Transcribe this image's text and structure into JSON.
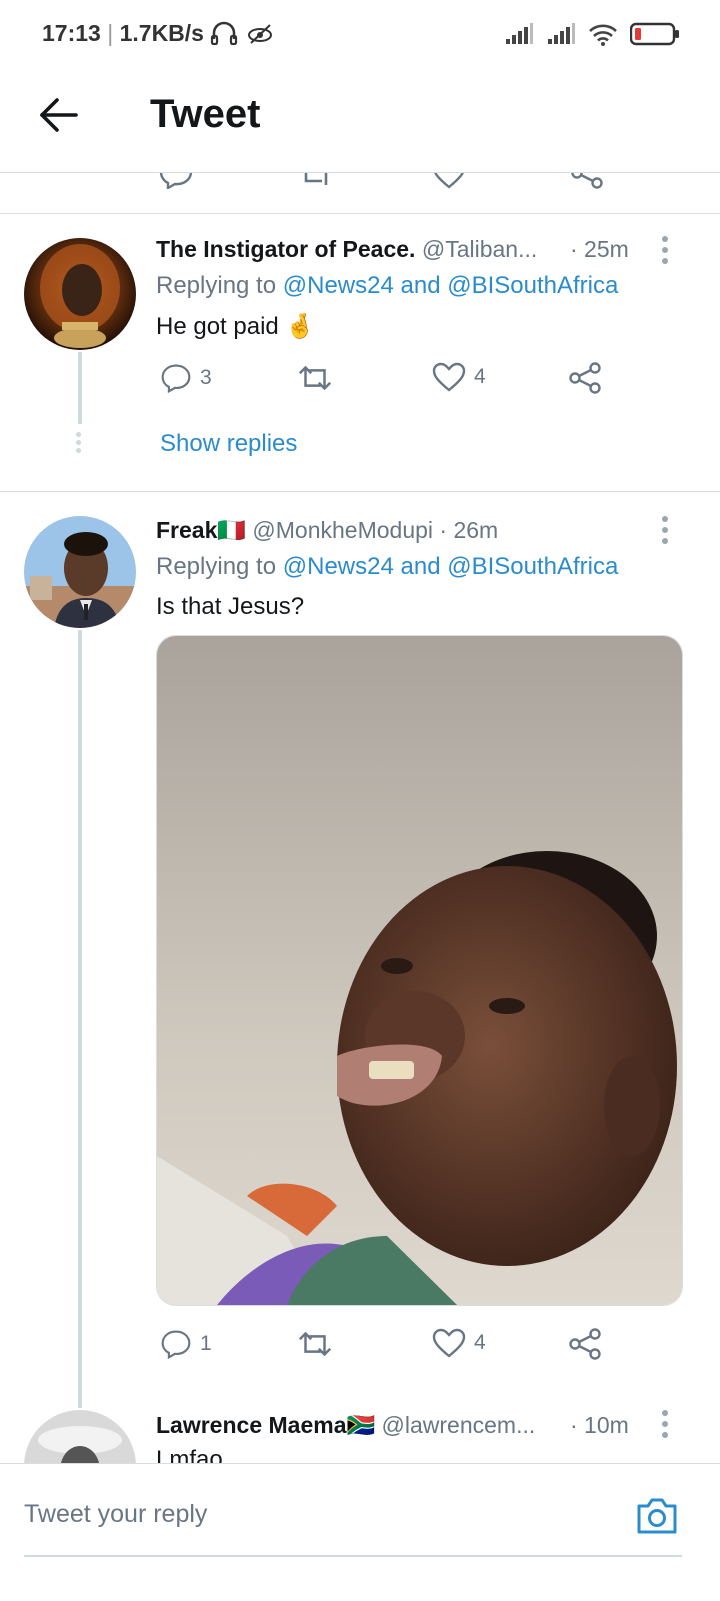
{
  "status_bar": {
    "time": "17:13",
    "speed": "1.7KB/s"
  },
  "header": {
    "title": "Tweet"
  },
  "tweets": [
    {
      "name": "The Instigator of Peace.",
      "handle": "@Taliban...",
      "time": "· 25m",
      "replying_prefix": "Replying to",
      "mention1": "@News24",
      "and": "and",
      "mention2": "@BISouthAfrica",
      "text": "He got paid 🤞",
      "replies": "3",
      "likes": "4",
      "show_replies": "Show replies"
    },
    {
      "name": "Freak🇮🇹",
      "handle": "@MonkheModupi",
      "time": "· 26m",
      "replying_prefix": "Replying to",
      "mention1": "@News24",
      "and": "and",
      "mention2": "@BISouthAfrica",
      "text": "Is that Jesus?",
      "replies": "1",
      "likes": "4"
    },
    {
      "name": "Lawrence Maema🇿🇦",
      "handle": "@lawrencem...",
      "time": "· 10m",
      "text": "Lmfao"
    }
  ],
  "composer": {
    "placeholder": "Tweet your reply"
  },
  "colors": {
    "accent": "#2a8ccc",
    "muted": "#687684",
    "separator": "#d8dde1"
  }
}
